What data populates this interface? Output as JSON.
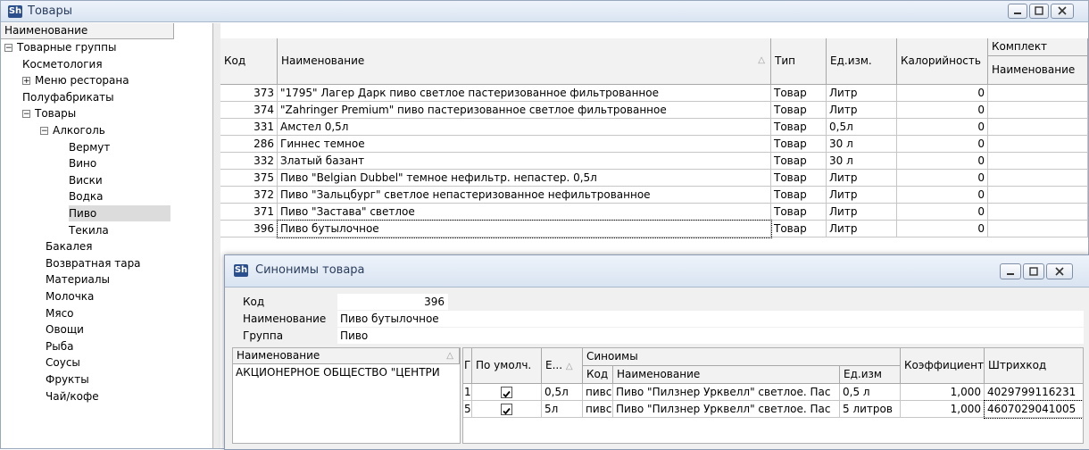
{
  "main_window": {
    "title": "Товары",
    "logo": "Sh",
    "tree_header": "Наименование",
    "tree": [
      {
        "label": "Товарные группы",
        "expander": "−"
      },
      {
        "label": "Косметология",
        "expander": ""
      },
      {
        "label": "Меню ресторана",
        "expander": "+"
      },
      {
        "label": "Полуфабрикаты",
        "expander": ""
      },
      {
        "label": "Товары",
        "expander": "−"
      },
      {
        "label": "Алкоголь",
        "expander": "−"
      },
      {
        "label": "Вермут",
        "expander": ""
      },
      {
        "label": "Вино",
        "expander": ""
      },
      {
        "label": "Виски",
        "expander": ""
      },
      {
        "label": "Водка",
        "expander": ""
      },
      {
        "label": "Пиво",
        "expander": ""
      },
      {
        "label": "Текила",
        "expander": ""
      },
      {
        "label": "Бакалея",
        "expander": ""
      },
      {
        "label": "Возвратная тара",
        "expander": ""
      },
      {
        "label": "Материалы",
        "expander": ""
      },
      {
        "label": "Молочка",
        "expander": ""
      },
      {
        "label": "Мясо",
        "expander": ""
      },
      {
        "label": "Овощи",
        "expander": ""
      },
      {
        "label": "Рыба",
        "expander": ""
      },
      {
        "label": "Соусы",
        "expander": ""
      },
      {
        "label": "Фрукты",
        "expander": ""
      },
      {
        "label": "Чай/кофе",
        "expander": ""
      }
    ],
    "grid": {
      "headers": {
        "code": "Код",
        "name": "Наименование",
        "type": "Тип",
        "unit": "Ед.изм.",
        "calories": "Калорийность",
        "kit": "Комплект",
        "kit_name": "Наименование"
      },
      "sort_indicator": "△",
      "rows": [
        {
          "code": "373",
          "name": "\"1795\" Лагер Дарк пиво светлое пастеризованное фильтрованное",
          "type": "Товар",
          "unit": "Литр",
          "calories": "0"
        },
        {
          "code": "374",
          "name": "\"Zahringer Premium\" пиво пастеризованное светлое фильтрованное",
          "type": "Товар",
          "unit": "Литр",
          "calories": "0"
        },
        {
          "code": "331",
          "name": "Амстел 0,5л",
          "type": "Товар",
          "unit": "0,5л",
          "calories": "0"
        },
        {
          "code": "286",
          "name": "Гиннес темное",
          "type": "Товар",
          "unit": "30 л",
          "calories": "0"
        },
        {
          "code": "332",
          "name": "Златый базант",
          "type": "Товар",
          "unit": "30 л",
          "calories": "0"
        },
        {
          "code": "375",
          "name": "Пиво \"Belgian Dubbel\" темное нефильтр. непастер. 0,5л",
          "type": "Товар",
          "unit": "Литр",
          "calories": "0"
        },
        {
          "code": "372",
          "name": "Пиво \"Зальцбург\" светлое непастеризованное нефильтрованное",
          "type": "Товар",
          "unit": "Литр",
          "calories": "0"
        },
        {
          "code": "371",
          "name": "Пиво \"Застава\" светлое",
          "type": "Товар",
          "unit": "Литр",
          "calories": "0"
        },
        {
          "code": "396",
          "name": "Пиво бутылочное",
          "type": "Товар",
          "unit": "Литр",
          "calories": "0"
        }
      ]
    }
  },
  "dialog": {
    "title": "Синонимы товара",
    "logo": "Sh",
    "code_label": "Код",
    "code_value": "396",
    "name_label": "Наименование",
    "name_value": "Пиво бутылочное",
    "group_label": "Группа",
    "group_value": "Пиво",
    "left_header": "Наименование",
    "left_row": "АКЦИОНЕРНОЕ ОБЩЕСТВО \"ЦЕНТРИ",
    "headers": {
      "first": "Г",
      "default": "По умолч.",
      "unit": "Е...",
      "synonyms": "Синоимы",
      "syn_code": "Код",
      "syn_name": "Наименование",
      "syn_unit": "Ед.изм",
      "coef": "Коэффициент",
      "barcode": "Штрихкод"
    },
    "rows": [
      {
        "num": "1",
        "unit": "0,5л",
        "syn_code": "пивс",
        "syn_name": "Пиво \"Пилзнер Урквелл\" светлое. Пас",
        "syn_unit": "0,5 л",
        "coef": "1,000",
        "barcode": "4029799116231"
      },
      {
        "num": "5",
        "unit": "5л",
        "syn_code": "пивс",
        "syn_name": "Пиво \"Пилзнер Урквелл\" светлое. Пас",
        "syn_unit": "5 литров",
        "coef": "1,000",
        "barcode": "4607029041005"
      }
    ]
  }
}
